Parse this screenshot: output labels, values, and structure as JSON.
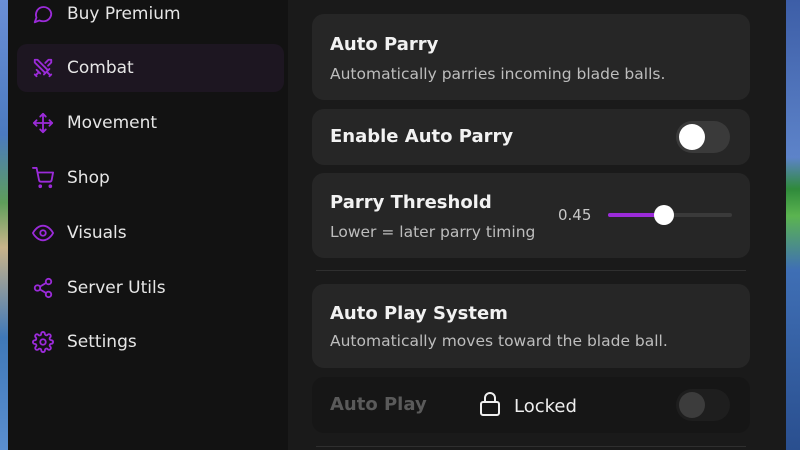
{
  "sidebar": {
    "items": [
      {
        "label": "Buy Premium",
        "icon": "chat-bubble-icon"
      },
      {
        "label": "Combat",
        "icon": "crossed-swords-icon",
        "active": true
      },
      {
        "label": "Movement",
        "icon": "move-arrows-icon"
      },
      {
        "label": "Shop",
        "icon": "shopping-cart-icon"
      },
      {
        "label": "Visuals",
        "icon": "eye-icon"
      },
      {
        "label": "Server Utils",
        "icon": "share-nodes-icon"
      },
      {
        "label": "Settings",
        "icon": "gear-icon"
      }
    ]
  },
  "main": {
    "auto_parry": {
      "title": "Auto Parry",
      "description": "Automatically parries incoming blade balls."
    },
    "enable_auto_parry": {
      "label": "Enable Auto Parry",
      "enabled": false
    },
    "parry_threshold": {
      "title": "Parry Threshold",
      "description": "Lower = later parry timing",
      "value_text": "0.45",
      "value": 0.45
    },
    "auto_play_system": {
      "title": "Auto Play System",
      "description": "Automatically moves toward the blade ball."
    },
    "auto_play": {
      "label": "Auto Play",
      "locked_text": "Locked",
      "enabled": false
    }
  },
  "colors": {
    "accent": "#9b2bd9",
    "sidebar_bg": "#121212",
    "panel_bg": "#1a1a1a",
    "card_bg": "#262626"
  }
}
